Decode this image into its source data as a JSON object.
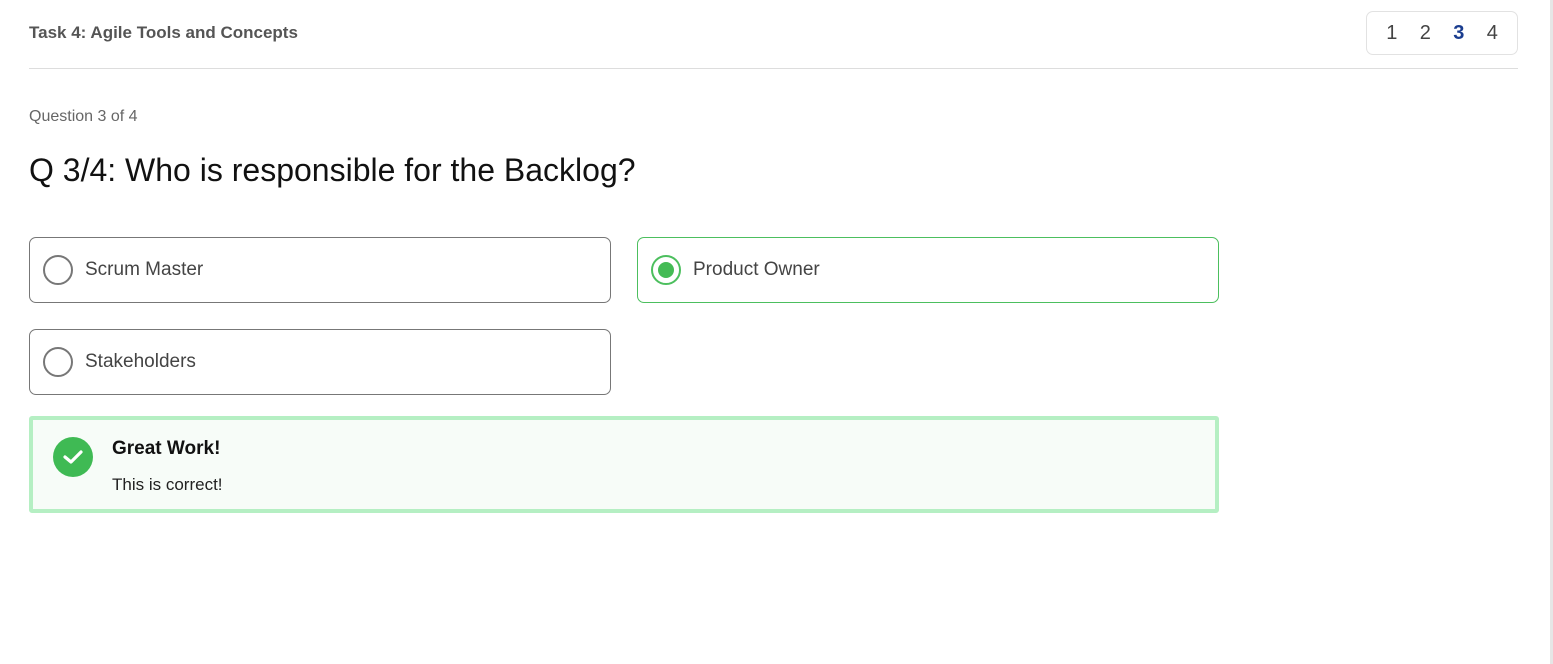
{
  "header": {
    "task_title": "Task 4: Agile Tools and Concepts",
    "pages": [
      "1",
      "2",
      "3",
      "4"
    ],
    "active_page": "3"
  },
  "question": {
    "counter": "Question 3 of 4",
    "title": "Q 3/4: Who is responsible for the Backlog?",
    "options": [
      {
        "label": "Scrum Master",
        "selected": false
      },
      {
        "label": "Product Owner",
        "selected": true
      },
      {
        "label": "Stakeholders",
        "selected": false
      }
    ]
  },
  "feedback": {
    "title": "Great Work!",
    "message": "This is correct!",
    "icon": "check-circle-icon"
  },
  "colors": {
    "accent_green": "#44bb55",
    "feedback_border": "#b5efc3",
    "active_page": "#1a3d8f"
  }
}
